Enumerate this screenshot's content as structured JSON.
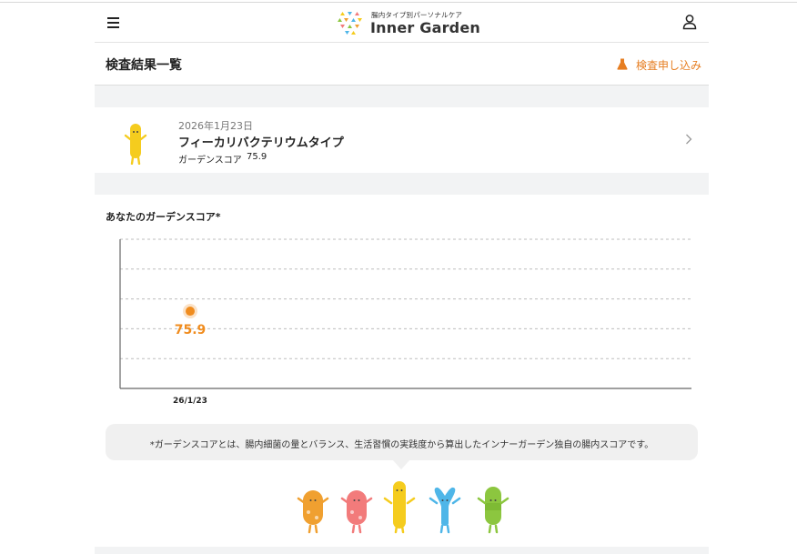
{
  "header": {
    "menu_icon": "hamburger-menu-icon",
    "logo_tagline": "腸内タイプ別パーソナルケア",
    "logo_name": "Inner Garden",
    "account_icon": "user-account-icon"
  },
  "page": {
    "title": "検査結果一覧",
    "apply_label": "検査申し込み",
    "apply_icon": "flask-icon"
  },
  "result": {
    "date": "2026年1月23日",
    "type_name": "フィーカリバクテリウムタイプ",
    "score_label": "ガーデンスコア",
    "score_value": "75.9",
    "character_icon": "yellow-bacterium-character",
    "chevron_icon": "chevron-right-icon"
  },
  "chart_data": {
    "type": "scatter",
    "title": "あなたのガーデンスコア*",
    "categories": [
      "26/1/23"
    ],
    "values": [
      75.9
    ],
    "value_labels": [
      "75.9"
    ],
    "grid": true,
    "point_color": "#f08c1e"
  },
  "note": {
    "text": "*ガーデンスコアとは、腸内細菌の量とバランス、生活習慣の実践度から算出したインナーガーデン独自の腸内スコアです。"
  },
  "mascots": [
    {
      "icon": "orange-bacterium-character",
      "color": "#f0a030"
    },
    {
      "icon": "pink-bacterium-character",
      "color": "#f27b7b"
    },
    {
      "icon": "yellow-bacterium-character",
      "color": "#f5cc1e"
    },
    {
      "icon": "blue-bacterium-character",
      "color": "#4fb6e8"
    },
    {
      "icon": "green-bacterium-character",
      "color": "#8cc63f"
    }
  ],
  "colors": {
    "accent": "#e67e22",
    "band": "#f2f3f4"
  }
}
